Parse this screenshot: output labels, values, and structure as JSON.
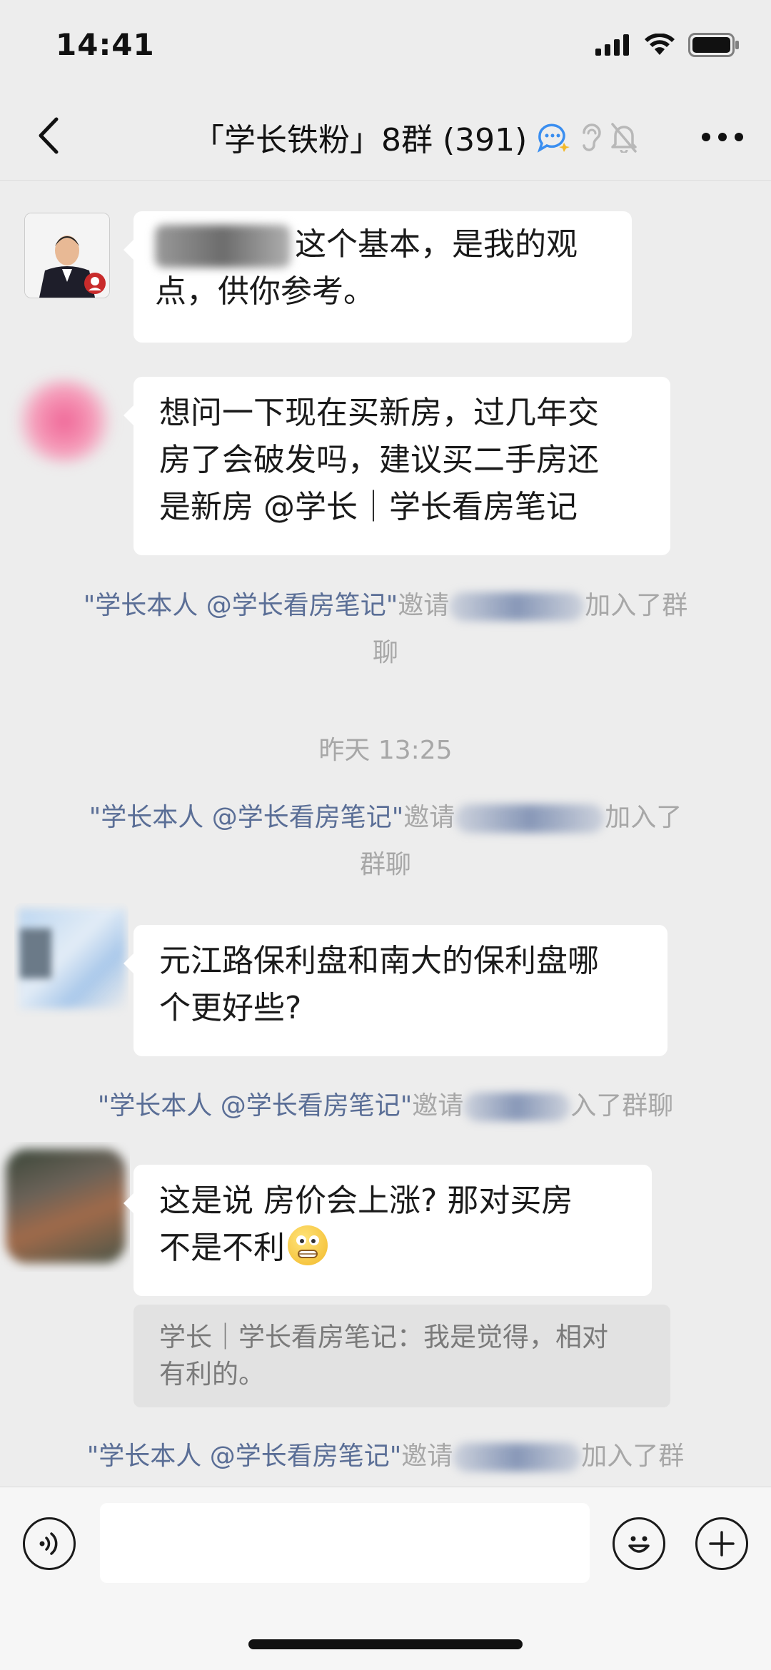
{
  "status": {
    "time": "14:41"
  },
  "nav": {
    "title": "「学长铁粉」8群 (391)"
  },
  "messages": [
    {
      "id": "m1",
      "text_line1": "这个基本，是我的观",
      "text_line2": "点，供你参考。"
    },
    {
      "id": "m2",
      "lines": [
        "想问一下现在买新房，过几年交",
        "房了会破发吗，建议买二手房还",
        "是新房 @学长｜学长看房笔记"
      ]
    },
    {
      "id": "m3",
      "lines": [
        "元江路保利盘和南大的保利盘哪",
        "个更好些?"
      ]
    },
    {
      "id": "m4",
      "line1": "这是说 房价会上涨?  那对买房",
      "line2": "不是不利"
    }
  ],
  "quote": {
    "line1": "学长｜学长看房笔记：我是觉得，相对",
    "line2": "有利的。"
  },
  "system_notices": [
    {
      "inviter": "\"学长本人 @学长看房笔记\"",
      "verb": "邀请",
      "tail1": "加入了群",
      "tail2": "聊"
    },
    {
      "inviter": "\"学长本人 @学长看房笔记\"",
      "verb": "邀请",
      "tail1": "加入了",
      "tail2": "群聊"
    },
    {
      "inviter": "\"学长本人 @学长看房笔记\"",
      "verb": "邀请",
      "tail1": "入了群聊"
    },
    {
      "inviter": "\"学长本人 @学长看房笔记\"",
      "verb": "邀请",
      "tail1": "加入了群"
    }
  ],
  "timestamp": "昨天 13:25",
  "icons": {
    "back": "chevron-left-icon",
    "more": "ellipsis-icon",
    "voice": "voice-icon",
    "emoji": "emoji-icon",
    "plus": "plus-icon"
  },
  "colors": {
    "background": "#ededed",
    "bubble": "#ffffff",
    "link": "#5a6e96",
    "system_text": "#a7a7a7"
  }
}
